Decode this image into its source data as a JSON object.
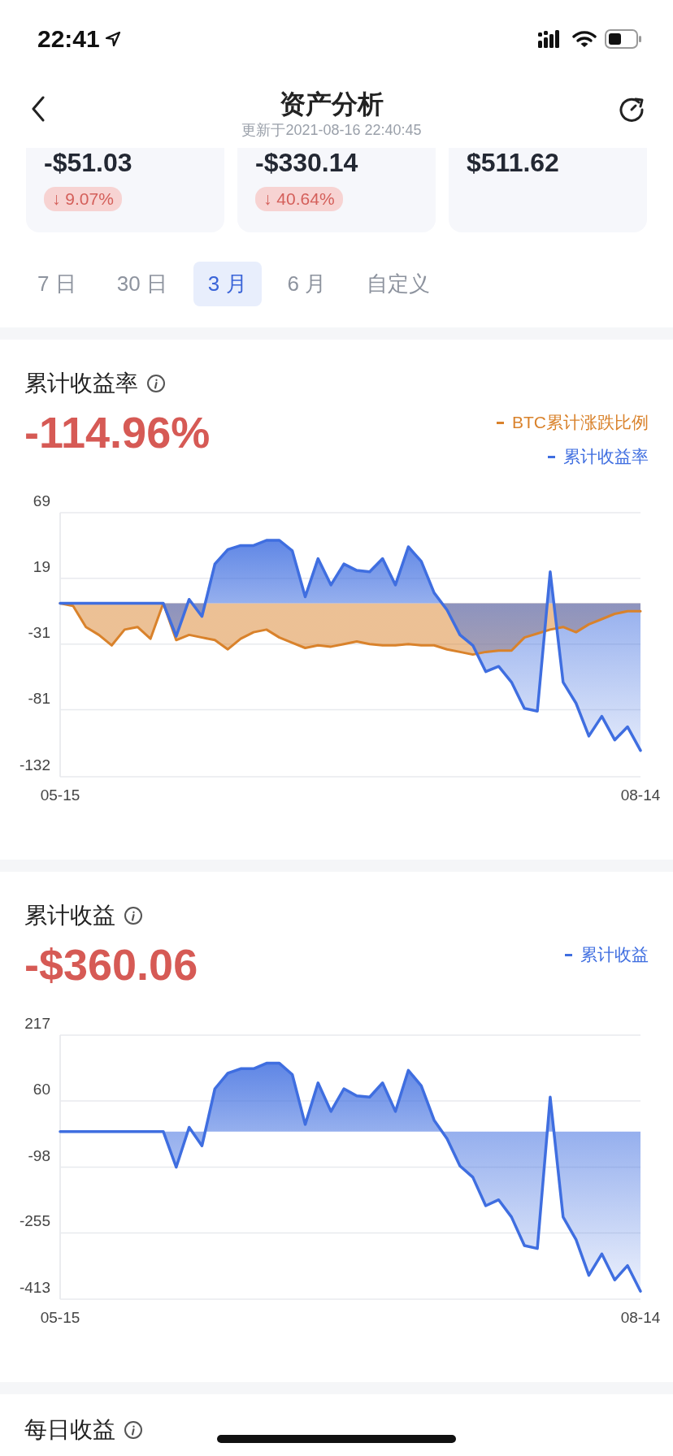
{
  "status_bar": {
    "time": "22:41"
  },
  "nav": {
    "title": "资产分析",
    "subtitle": "更新于2021-08-16 22:40:45"
  },
  "summary_cards": [
    {
      "amount": "-$51.03",
      "change": "↓ 9.07%"
    },
    {
      "amount": "-$330.14",
      "change": "↓ 40.64%"
    },
    {
      "amount": "$511.62"
    }
  ],
  "range_tabs": [
    {
      "label": "7 日",
      "selected": false
    },
    {
      "label": "30 日",
      "selected": false
    },
    {
      "label": "3 月",
      "selected": true
    },
    {
      "label": "6 月",
      "selected": false
    },
    {
      "label": "自定义",
      "selected": false
    }
  ],
  "sections": [
    {
      "title": "累计收益率",
      "value": "-114.96%",
      "chart_data": {
        "type": "area",
        "categories": [
          "05-15",
          null,
          null,
          null,
          null,
          null,
          null,
          null,
          null,
          null,
          null,
          null,
          null,
          null,
          null,
          null,
          null,
          null,
          null,
          null,
          null,
          null,
          null,
          null,
          null,
          null,
          null,
          null,
          null,
          null,
          null,
          null,
          null,
          null,
          null,
          null,
          null,
          null,
          null,
          null,
          null,
          null,
          null,
          null,
          null,
          "08-14"
        ],
        "series": [
          {
            "name": "BTC累计涨跌比例",
            "color": "#d9822b",
            "values": [
              0,
              -2,
              -18,
              -24,
              -32,
              -20,
              -18,
              -27,
              0,
              -28,
              -24,
              -26,
              -28,
              -35,
              -27,
              -22,
              -20,
              -26,
              -30,
              -34,
              -32,
              -33,
              -31,
              -29,
              -31,
              -32,
              -32,
              -31,
              -32,
              -32,
              -35,
              -37,
              -39,
              -37,
              -36,
              -36,
              -26,
              -23,
              -20,
              -18,
              -22,
              -16,
              -12,
              -8,
              -6,
              -6
            ]
          },
          {
            "name": "累计收益率",
            "color": "#3f6ee0",
            "values": [
              0,
              0,
              0,
              0,
              0,
              0,
              0,
              0,
              0,
              -25,
              3,
              -10,
              30,
              41,
              44,
              44,
              48,
              48,
              40,
              5,
              34,
              14,
              30,
              25,
              24,
              34,
              14,
              43,
              32,
              8,
              -5,
              -24,
              -32,
              -52,
              -48,
              -60,
              -80,
              -82,
              24,
              -60,
              -76,
              -101,
              -86,
              -104,
              -94,
              -112
            ]
          }
        ],
        "ylim": [
          -132,
          69
        ],
        "yticks": [
          69,
          19,
          -31,
          -81,
          -132
        ],
        "grid": true
      }
    },
    {
      "title": "累计收益",
      "value": "-$360.06",
      "chart_data": {
        "type": "area",
        "categories": [
          "05-15",
          null,
          null,
          null,
          null,
          null,
          null,
          null,
          null,
          null,
          null,
          null,
          null,
          null,
          null,
          null,
          null,
          null,
          null,
          null,
          null,
          null,
          null,
          null,
          null,
          null,
          null,
          null,
          null,
          null,
          null,
          null,
          null,
          null,
          null,
          null,
          null,
          null,
          null,
          null,
          null,
          null,
          null,
          null,
          null,
          "08-14"
        ],
        "series": [
          {
            "name": "累计收益",
            "color": "#3f6ee0",
            "values": [
              -13,
              -13,
              -13,
              -13,
              -13,
              -13,
              -13,
              -13,
              -13,
              -98,
              -3,
              -47,
              89,
              126,
              137,
              137,
              150,
              150,
              123,
              4,
              103,
              35,
              89,
              72,
              69,
              103,
              35,
              133,
              96,
              14,
              -30,
              -95,
              -122,
              -190,
              -176,
              -217,
              -285,
              -292,
              69,
              -217,
              -271,
              -356,
              -305,
              -367,
              -333,
              -394
            ]
          }
        ],
        "ylim": [
          -413,
          217
        ],
        "yticks": [
          217,
          60,
          -98,
          -255,
          -413
        ],
        "grid": true
      }
    },
    {
      "title": "每日收益"
    }
  ]
}
